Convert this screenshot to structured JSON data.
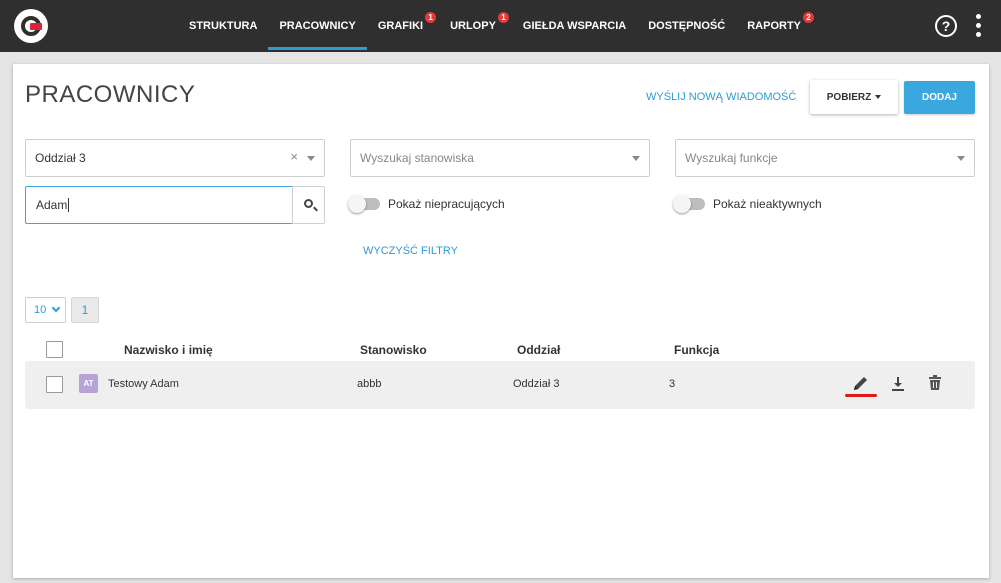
{
  "nav": {
    "items": [
      {
        "label": "STRUKTURA",
        "badge": null,
        "active": false
      },
      {
        "label": "PRACOWNICY",
        "badge": null,
        "active": true
      },
      {
        "label": "GRAFIKI",
        "badge": "1",
        "active": false
      },
      {
        "label": "URLOPY",
        "badge": "1",
        "active": false
      },
      {
        "label": "GIEŁDA WSPARCIA",
        "badge": null,
        "active": false
      },
      {
        "label": "DOSTĘPNOŚĆ",
        "badge": null,
        "active": false
      },
      {
        "label": "RAPORTY",
        "badge": "2",
        "active": false
      }
    ],
    "help_label": "?"
  },
  "header": {
    "title": "PRACOWNICY",
    "send_message_link": "WYŚLIJ NOWĄ WIADOMOŚĆ",
    "download_button": "POBIERZ",
    "add_button": "DODAJ"
  },
  "filters": {
    "department": {
      "value": "Oddział 3",
      "clear": "×"
    },
    "position": {
      "placeholder": "Wyszukaj stanowiska"
    },
    "function": {
      "placeholder": "Wyszukaj funkcje"
    },
    "search": {
      "value": "Adam"
    },
    "show_not_working": "Pokaż niepracujących",
    "show_inactive": "Pokaż nieaktywnych",
    "clear_filters": "WYCZYŚĆ FILTRY"
  },
  "pagination": {
    "page_size": "10",
    "current_page": "1"
  },
  "table": {
    "headers": {
      "name": "Nazwisko i imię",
      "position": "Stanowisko",
      "department": "Oddział",
      "function": "Funkcja"
    },
    "rows": [
      {
        "initials": "AT",
        "name": "Testowy Adam",
        "position": "abbb",
        "department": "Oddział 3",
        "function": "3"
      }
    ]
  },
  "colors": {
    "topbar": "#2f2f2f",
    "accent": "#2e9bd6",
    "add_button": "#3aa7df",
    "badge": "#e03a3a",
    "avatar": "#b7a3d6",
    "highlight_underline": "#e01818"
  }
}
